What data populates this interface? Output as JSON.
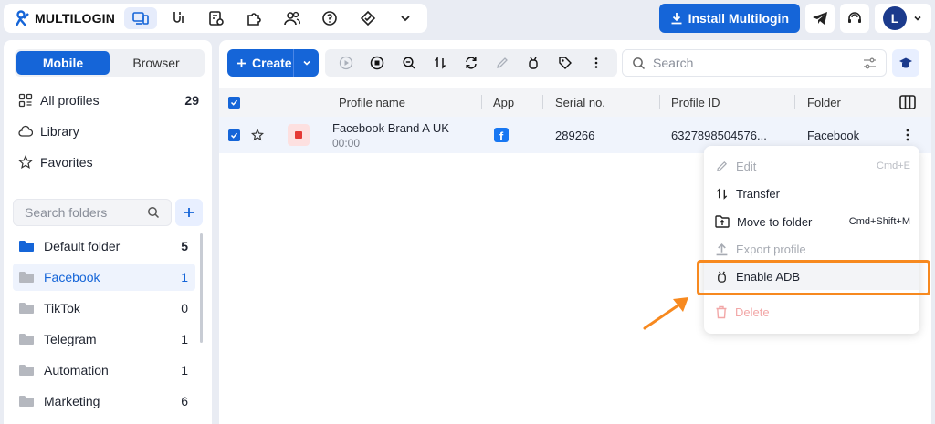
{
  "brand": {
    "name": "MULTILOGIN",
    "accent": "#1565d8",
    "highlight": "#f7891f"
  },
  "topnav": {
    "icons": [
      "devices-icon",
      "cookie-robot-icon",
      "automation-icon",
      "extensions-icon",
      "team-icon",
      "help-icon",
      "referral-icon",
      "chevron-down-icon"
    ],
    "install_label": "Install Multilogin",
    "avatar_letter": "L"
  },
  "sidebar": {
    "tabs": [
      {
        "label": "Mobile",
        "active": true
      },
      {
        "label": "Browser",
        "active": false
      }
    ],
    "items": [
      {
        "label": "All profiles",
        "count": "29"
      },
      {
        "label": "Library"
      },
      {
        "label": "Favorites"
      }
    ],
    "folder_search_placeholder": "Search folders",
    "folders": [
      {
        "label": "Default folder",
        "count": "5"
      },
      {
        "label": "Facebook",
        "count": "1",
        "selected": true
      },
      {
        "label": "TikTok",
        "count": "0"
      },
      {
        "label": "Telegram",
        "count": "1"
      },
      {
        "label": "Automation",
        "count": "1"
      },
      {
        "label": "Marketing",
        "count": "6"
      }
    ]
  },
  "main": {
    "create_label": "Create",
    "search_placeholder": "Search",
    "columns": [
      "Profile name",
      "App",
      "Serial no.",
      "Profile ID",
      "Folder"
    ],
    "row": {
      "name": "Facebook Brand A UK",
      "time": "00:00",
      "serial": "289266",
      "profile_id": "6327898504576...",
      "folder": "Facebook"
    }
  },
  "context_menu": {
    "items": [
      {
        "label": "Edit",
        "shortcut": "Cmd+E",
        "disabled": true
      },
      {
        "label": "Transfer"
      },
      {
        "label": "Move to folder",
        "shortcut": "Cmd+Shift+M"
      },
      {
        "label": "Export profile",
        "disabled": true
      },
      {
        "label": "Enable ADB",
        "highlighted": true
      },
      {
        "label": "Delete",
        "disabled": true
      }
    ]
  }
}
